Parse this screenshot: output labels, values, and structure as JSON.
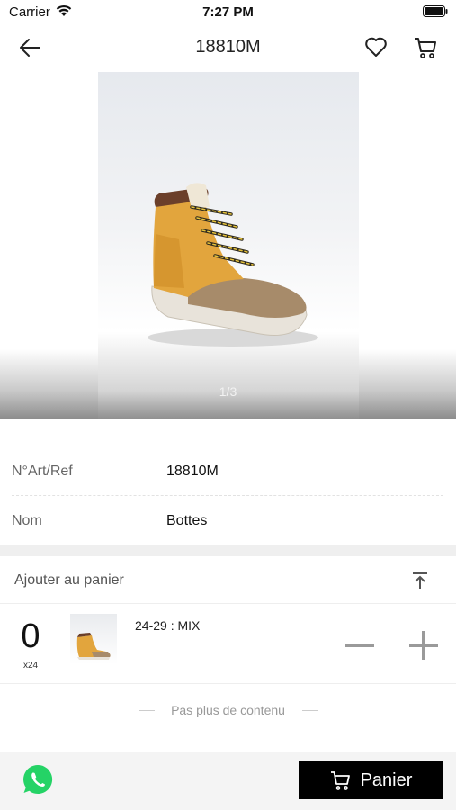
{
  "status": {
    "carrier": "Carrier",
    "time": "7:27 PM"
  },
  "nav": {
    "title": "18810M",
    "icons": [
      "back-arrow-icon",
      "heart-icon",
      "cart-icon"
    ]
  },
  "gallery": {
    "pager": "1/3",
    "image_description_icon": "boot-photo"
  },
  "details": {
    "rows": [
      {
        "label": "N°Art/Ref",
        "value": "18810M"
      },
      {
        "label": "Nom",
        "value": "Bottes"
      }
    ]
  },
  "add_to_cart": {
    "title": "Ajouter au panier",
    "collapse_icon": "collapse-up-icon"
  },
  "variant": {
    "quantity": "0",
    "pack": "x24",
    "label": "24-29 : MIX"
  },
  "footer_note": "Pas plus de contenu",
  "bottom": {
    "cart_button_label": "Panier",
    "whatsapp_color": "#25D366"
  },
  "colors": {
    "boot": "#e0a23a",
    "cart_button_bg": "#000000"
  }
}
